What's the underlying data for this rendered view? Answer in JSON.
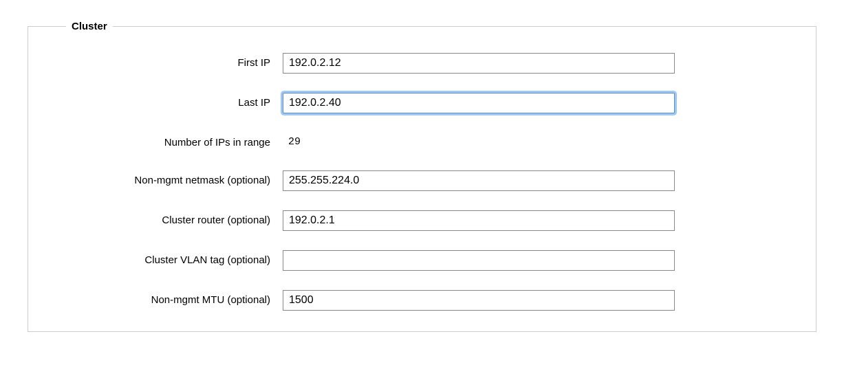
{
  "fieldset": {
    "legend": "Cluster",
    "rows": {
      "first_ip": {
        "label": "First IP",
        "value": "192.0.2.12"
      },
      "last_ip": {
        "label": "Last IP",
        "value": "192.0.2.40"
      },
      "ip_count": {
        "label": "Number of IPs in range",
        "value": "29"
      },
      "non_mgmt_netmask": {
        "label": "Non-mgmt netmask (optional)",
        "value": "255.255.224.0"
      },
      "cluster_router": {
        "label": "Cluster router (optional)",
        "value": "192.0.2.1"
      },
      "cluster_vlan_tag": {
        "label": "Cluster VLAN tag (optional)",
        "value": ""
      },
      "non_mgmt_mtu": {
        "label": "Non-mgmt MTU (optional)",
        "value": "1500"
      }
    }
  }
}
